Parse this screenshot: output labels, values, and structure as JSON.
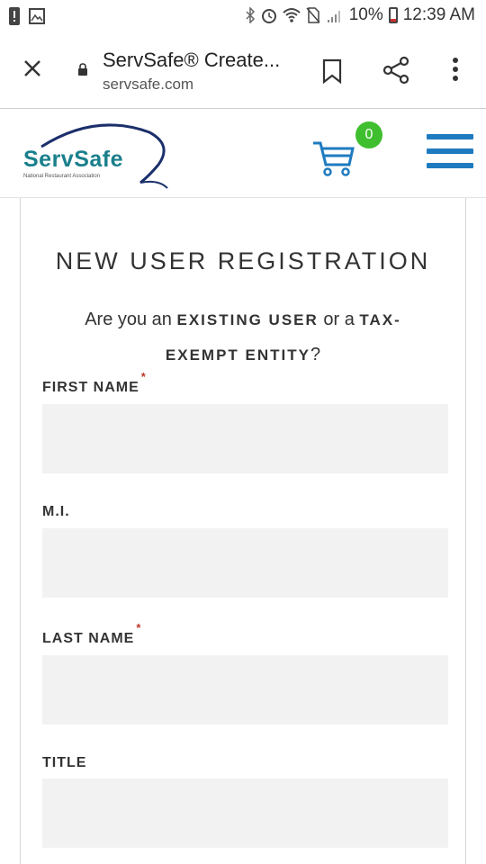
{
  "status_bar": {
    "battery_percent": "10%",
    "time": "12:39 AM",
    "icons": [
      "alert-icon",
      "image-icon",
      "bluetooth-icon",
      "alarm-icon",
      "wifi-icon",
      "no-sim-icon",
      "signal-icon",
      "battery-icon"
    ]
  },
  "browser": {
    "page_title": "ServSafe® Create...",
    "domain": "servsafe.com"
  },
  "site": {
    "logo_text": "ServSafe",
    "logo_subtitle": "National Restaurant Association",
    "cart_count": "0",
    "colors": {
      "brand_teal": "#1a7f8c",
      "menu_blue": "#1f7bc0",
      "badge_green": "#3fbf2e"
    }
  },
  "form": {
    "title": "NEW USER REGISTRATION",
    "question_pre": "Are you an",
    "question_existing": "EXISTING USER",
    "question_mid": "or a",
    "question_tax": "TAX-",
    "question_exempt": "EXEMPT ENTITY",
    "question_end": "?",
    "required_mark": "*",
    "fields": [
      {
        "label": "FIRST NAME",
        "required": true,
        "value": ""
      },
      {
        "label": "M.I.",
        "required": false,
        "value": ""
      },
      {
        "label": "LAST NAME",
        "required": true,
        "value": ""
      },
      {
        "label": "TITLE",
        "required": false,
        "value": ""
      }
    ]
  }
}
